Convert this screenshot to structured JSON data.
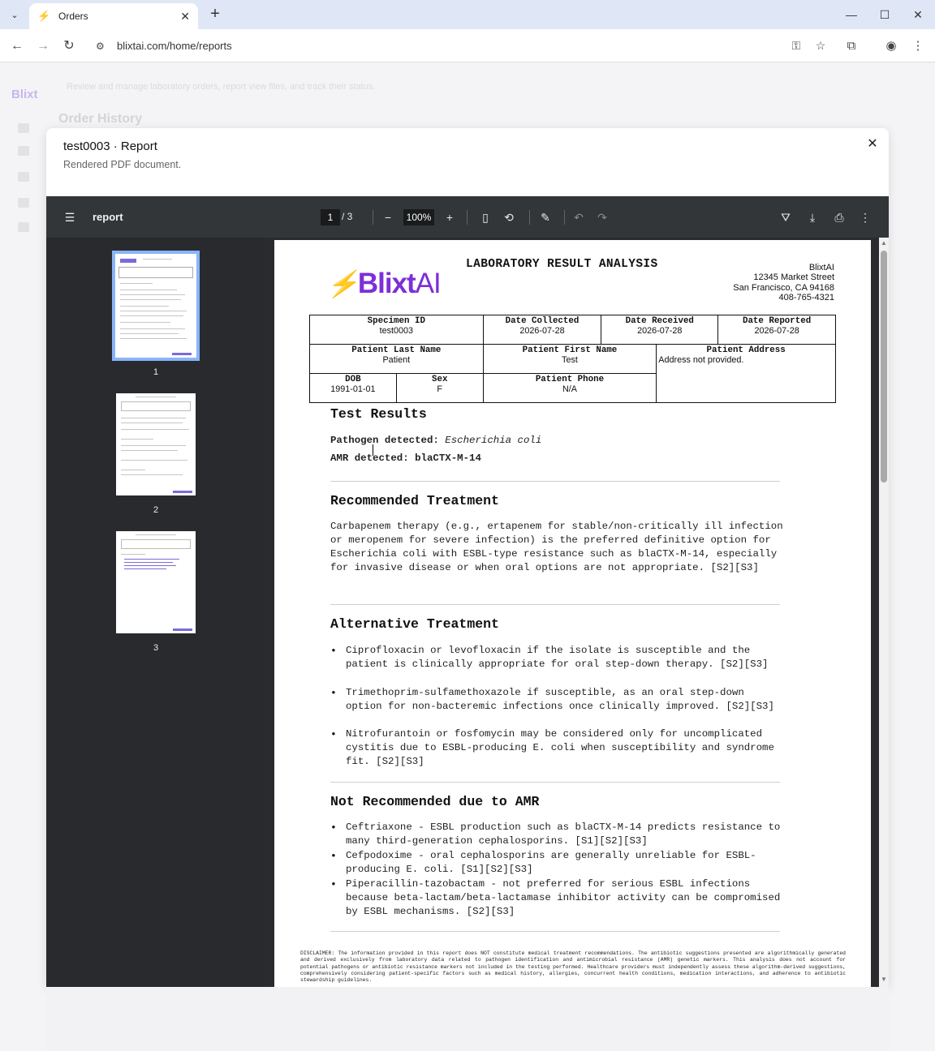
{
  "browser": {
    "tab_title": "Orders",
    "url": "blixtai.com/home/reports"
  },
  "background_app": {
    "logo": "Blixt",
    "page_title": "Order History",
    "subtitle": "Review and manage laboratory orders, report view files, and track their status."
  },
  "modal": {
    "title": "test0003 · Report",
    "subtitle": "Rendered PDF document."
  },
  "viewer": {
    "doc_name": "report",
    "current_page": "1",
    "total_pages": "/ 3",
    "zoom": "100%",
    "thumbnails": [
      "1",
      "2",
      "3"
    ]
  },
  "report": {
    "logo_text": "Blixt",
    "logo_ai": "AI",
    "title": "LABORATORY RESULT ANALYSIS",
    "lab": {
      "name": "BlixtAI",
      "street": "12345 Market Street",
      "city": "San Francisco, CA 94168",
      "phone": "408-765-4321"
    },
    "fields": {
      "specimen_id_label": "Specimen ID",
      "specimen_id": "test0003",
      "date_collected_label": "Date Collected",
      "date_collected": "2026-07-28",
      "date_received_label": "Date Received",
      "date_received": "2026-07-28",
      "date_reported_label": "Date Reported",
      "date_reported": "2026-07-28",
      "last_name_label": "Patient Last Name",
      "last_name": "Patient",
      "first_name_label": "Patient First Name",
      "first_name": "Test",
      "address_label": "Patient Address",
      "address": "Address not provided.",
      "dob_label": "DOB",
      "dob": "1991-01-01",
      "sex_label": "Sex",
      "sex": "F",
      "phone_label": "Patient Phone",
      "phone": "N/A"
    },
    "test_results": {
      "heading": "Test Results",
      "pathogen_label": "Pathogen detected:",
      "pathogen": "Escherichia coli",
      "amr_label": "AMR detected:",
      "amr": "blaCTX-M-14"
    },
    "recommended": {
      "heading": "Recommended Treatment",
      "text": "Carbapenem therapy (e.g., ertapenem for stable/non-critically ill infection or meropenem for severe infection) is the preferred definitive option for Escherichia coli with ESBL-type resistance such as blaCTX-M-14, especially for invasive disease or when oral options are not appropriate. [S2][S3]"
    },
    "alternative": {
      "heading": "Alternative Treatment",
      "items": [
        "Ciprofloxacin or levofloxacin if the isolate is susceptible and the patient is clinically appropriate for oral step-down therapy. [S2][S3]",
        "Trimethoprim-sulfamethoxazole if susceptible, as an oral step-down option for non-bacteremic infections once clinically improved. [S2][S3]",
        "Nitrofurantoin or fosfomycin may be considered only for uncomplicated cystitis due to ESBL-producing E. coli when susceptibility and syndrome fit. [S2][S3]"
      ]
    },
    "not_recommended": {
      "heading": "Not Recommended due to AMR",
      "items": [
        "Ceftriaxone - ESBL production such as blaCTX-M-14 predicts resistance to many third-generation cephalosporins. [S1][S2][S3]",
        "Cefpodoxime - oral cephalosporins are generally unreliable for ESBL-producing E. coli. [S1][S2][S3]",
        "Piperacillin-tazobactam - not preferred for serious ESBL infections because beta-lactam/beta-lactamase inhibitor activity can be compromised by ESBL mechanisms. [S2][S3]"
      ]
    },
    "disclaimer": "DISCLAIMER: The information provided in this report does NOT constitute medical treatment recommendations. The antibiotic suggestions presented are algorithmically generated and derived exclusively from laboratory data related to pathogen identification and antimicrobial resistance (AMR) genetic markers. This analysis does not account for potential pathogens or antibiotic resistance markers not included in the testing performed. Healthcare providers must independently assess these algorithm-derived suggestions, comprehensively considering patient-specific factors such as medical history, allergies, concurrent health conditions, medication interactions, and adherence to antibiotic stewardship guidelines."
  },
  "colors": {
    "brand": "#7d2fd8",
    "viewer_toolbar": "#323639",
    "thumb_selected": "#8ab4f8"
  }
}
